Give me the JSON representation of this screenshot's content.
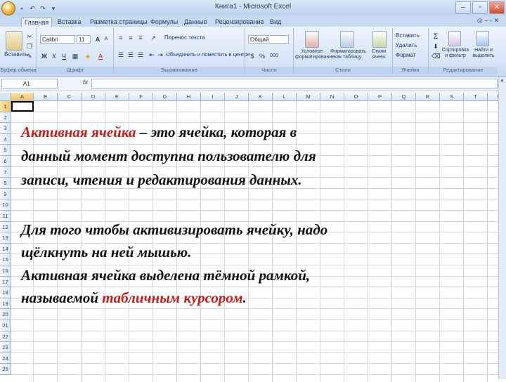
{
  "window": {
    "title": "Книга1 - Microsoft Excel",
    "minimize": "–",
    "restore": "▫",
    "close": "✕"
  },
  "quick_access": [
    "↶",
    "↷",
    "▾"
  ],
  "tabs": [
    "Главная",
    "Вставка",
    "Разметка страницы",
    "Формулы",
    "Данные",
    "Рецензирование",
    "Вид"
  ],
  "help": "◎ – ▫ ✕",
  "ribbon": {
    "clipboard": {
      "label": "Буфер обмена",
      "paste": "Вставить"
    },
    "font": {
      "label": "Шрифт",
      "name": "Calibri",
      "size": "11",
      "grow": "A",
      "shrink": "A",
      "bold": "Ж",
      "italic": "К",
      "underline": "Ч",
      "fill": "◈",
      "color": "A"
    },
    "alignment": {
      "label": "Выравнивание",
      "wrap": "Перенос текста",
      "merge": "Объединить и поместить в центре"
    },
    "number": {
      "label": "Число",
      "format": "Общий",
      "percent": "%",
      "thousands": "000"
    },
    "styles": {
      "label": "Стили",
      "conditional": "Условное форматирование",
      "as_table": "Форматировать как таблицу",
      "cell_styles": "Стили ячеек"
    },
    "cells": {
      "label": "Ячейки",
      "insert": "Вставить",
      "delete": "Удалить",
      "format": "Формат"
    },
    "editing": {
      "label": "Редактирование",
      "sum": "Σ",
      "sort": "Сортировка и фильтр",
      "find": "Найти и выделить"
    }
  },
  "formula_bar": {
    "name_box": "A1",
    "fx": "fx",
    "value": ""
  },
  "columns": [
    "A",
    "B",
    "C",
    "D",
    "E",
    "F",
    "G",
    "H",
    "I",
    "J",
    "K",
    "L",
    "M",
    "N",
    "O",
    "P",
    "Q",
    "R",
    "S",
    "T",
    "U"
  ],
  "rows": [
    "1",
    "2",
    "3",
    "4",
    "5",
    "6",
    "7",
    "8",
    "9",
    "10",
    "11",
    "12",
    "13",
    "14",
    "15",
    "16",
    "17",
    "18",
    "19",
    "20",
    "21",
    "22",
    "23",
    "24",
    "25"
  ],
  "slide_text": {
    "l1_term": "Активная  ячейка",
    "l1_rest": " – это  ячейка, которая  в",
    "l2": "данный  момент доступна  пользователю  для",
    "l3": "записи,  чтения   и редактирования   данных.",
    "l4": "Для   того   чтобы   активизировать  ячейку, надо",
    "l5": "щёлкнуть на  ней мышью.",
    "l6": "Активная ячейка выделена тёмной рамкой,",
    "l7_start": "называемой ",
    "l7_term": "табличным курсором",
    "l7_end": "."
  },
  "colors": {
    "accent_red": "#c0201c",
    "ribbon": "#d7e5f7",
    "header_selected": "#f4c368"
  }
}
